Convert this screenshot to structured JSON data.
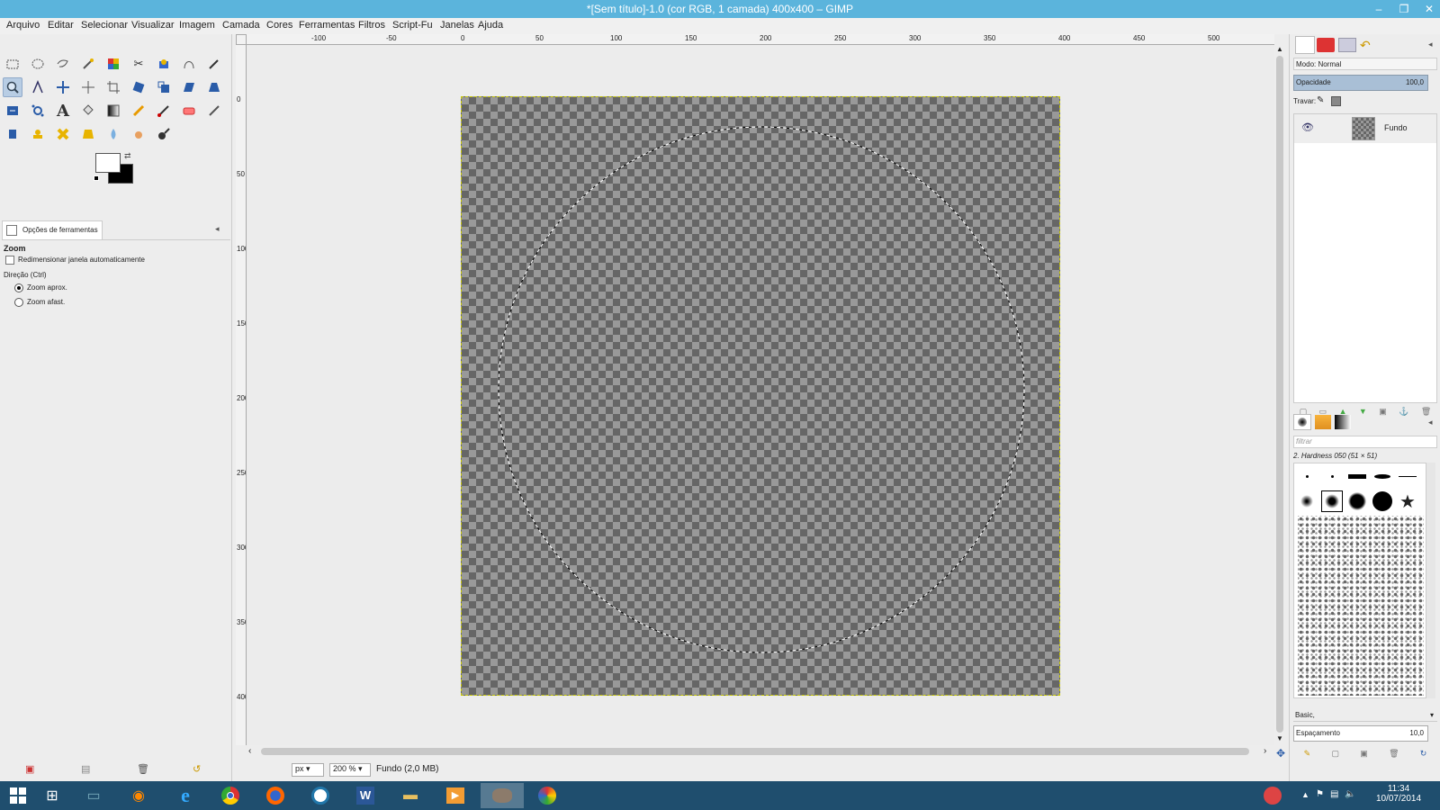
{
  "window": {
    "title": "*[Sem título]-1.0 (cor RGB, 1 camada) 400x400 – GIMP"
  },
  "menu": [
    "Arquivo",
    "Editar",
    "Selecionar",
    "Visualizar",
    "Imagem",
    "Camada",
    "Cores",
    "Ferramentas",
    "Filtros",
    "Script-Fu",
    "Janelas",
    "Ajuda"
  ],
  "tool_options": {
    "tab_label": "Opções de ferramentas",
    "tool_name": "Zoom",
    "auto_resize_label": "Redimensionar janela automaticamente",
    "direction_label": "Direção (Ctrl)",
    "zoom_in_label": "Zoom aprox.",
    "zoom_out_label": "Zoom afast."
  },
  "hruler_labels": [
    "-100",
    "-50",
    "0",
    "50",
    "100",
    "150",
    "200",
    "250",
    "300",
    "350",
    "400",
    "450",
    "500"
  ],
  "vruler_labels": [
    "0",
    "50",
    "100",
    "150",
    "200",
    "250",
    "300",
    "350",
    "400"
  ],
  "status": {
    "unit": "px",
    "zoom": "200 %",
    "info": "Fundo (2,0 MB)"
  },
  "layers": {
    "mode_label": "Modo: Normal",
    "opacity_label": "Opacidade",
    "opacity_value": "100,0",
    "lock_label": "Travar:",
    "layer_name": "Fundo"
  },
  "brushes": {
    "filter_placeholder": "filtrar",
    "selected_brush": "2. Hardness 050 (51 × 51)",
    "preset": "Basic,",
    "spacing_label": "Espaçamento",
    "spacing_value": "10,0"
  },
  "clock": {
    "time": "11:34",
    "date": "10/07/2014"
  },
  "colors": {
    "titlebar": "#5bb4dc",
    "taskbar": "#1f4e6e",
    "selection": "#b8cde4"
  }
}
